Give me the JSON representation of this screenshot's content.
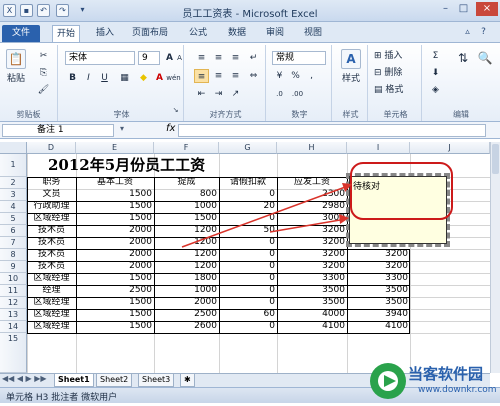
{
  "window": {
    "title": "员工工资表 - Microsoft Excel",
    "help": "?",
    "minimize": "–",
    "maximize": "□",
    "close": "×"
  },
  "quick_access": [
    "save",
    "undo",
    "redo",
    "customize"
  ],
  "ribbon_tabs": [
    "文件",
    "开始",
    "插入",
    "页面布局",
    "公式",
    "数据",
    "审阅",
    "视图"
  ],
  "ribbon": {
    "clipboard": {
      "label": "剪贴板",
      "paste": "粘贴"
    },
    "font": {
      "label": "字体",
      "name": "宋体",
      "size": "9",
      "bold": "B",
      "italic": "I",
      "underline": "U",
      "grow": "A",
      "shrink": "A",
      "wen": "wén"
    },
    "alignment": {
      "label": "对齐方式"
    },
    "number": {
      "label": "数字",
      "format": "常规",
      "pct": "%",
      "comma": ",",
      "inc": ".0",
      "dec": ".00",
      "currency": "¥"
    },
    "styles": {
      "label": "样式",
      "styles_btn": "样式"
    },
    "cells": {
      "label": "单元格",
      "insert": "插入",
      "delete": "删除",
      "format": "格式"
    },
    "editing": {
      "label": "编辑"
    }
  },
  "formula_bar": {
    "name_box": "备注 1",
    "fx": "fx",
    "formula": ""
  },
  "sheet": {
    "columns": [
      "D",
      "E",
      "F",
      "G",
      "H",
      "I",
      "J"
    ],
    "rows": [
      "1",
      "2",
      "3",
      "4",
      "5",
      "6",
      "7",
      "8",
      "9",
      "10",
      "11",
      "12",
      "13",
      "14",
      "15"
    ],
    "title": "2012年5月份员工工资",
    "headers": [
      "职务",
      "基本工资",
      "提成",
      "请假扣款",
      "应发工资"
    ],
    "data": [
      [
        "文员",
        "1500",
        "800",
        "0",
        "2300"
      ],
      [
        "行政助理",
        "1500",
        "1000",
        "20",
        "2980"
      ],
      [
        "区域经理",
        "1500",
        "1500",
        "0",
        "3000"
      ],
      [
        "技术员",
        "2000",
        "1200",
        "50",
        "3200"
      ],
      [
        "技术员",
        "2000",
        "1200",
        "0",
        "3200"
      ],
      [
        "技术员",
        "2000",
        "1200",
        "0",
        "3200"
      ],
      [
        "技术员",
        "2000",
        "1200",
        "0",
        "3200"
      ],
      [
        "区域经理",
        "1500",
        "1800",
        "0",
        "3300"
      ],
      [
        "经理",
        "2500",
        "1000",
        "0",
        "3500"
      ],
      [
        "区域经理",
        "1500",
        "2000",
        "0",
        "3500"
      ],
      [
        "区域经理",
        "1500",
        "2500",
        "60",
        "4000"
      ],
      [
        "区域经理",
        "1500",
        "2600",
        "0",
        "4100"
      ]
    ],
    "col_i_values": [
      "",
      "",
      "",
      "",
      "",
      "3200",
      "3200",
      "3200",
      "3300",
      "3500",
      "3500",
      "3940",
      "4100"
    ]
  },
  "comment": {
    "text": "待核对"
  },
  "sheet_tabs": [
    "Sheet1",
    "Sheet2",
    "Sheet3"
  ],
  "status": {
    "text": "单元格 H3 批注者 微软用户"
  },
  "watermark": {
    "brand": "当客软件园",
    "url": "www.downkr.com"
  },
  "colors": {
    "file_tab": "#2a61ad",
    "ribbon_bg": "#dfe9f5",
    "comment_bg": "#ffffe1",
    "arrow": "#d9342b",
    "highlight": "#cc1a1a"
  }
}
